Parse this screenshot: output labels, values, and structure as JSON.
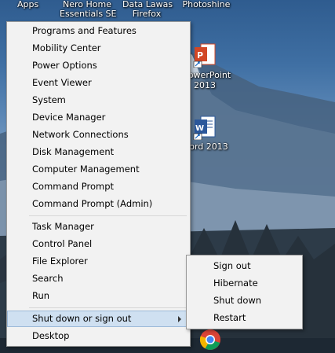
{
  "desktop": {
    "top_labels": {
      "apps": "Apps",
      "nero_line1": "Nero Home",
      "nero_line2": "Essentials SE",
      "data_line1": "Data Lawas",
      "data_line2": "Firefox",
      "photoshine": "Photoshine"
    },
    "icons": {
      "powerpoint_line1": "owerPoint",
      "powerpoint_line2": "2013",
      "word_label": "ord 2013"
    }
  },
  "context_menu": {
    "items": [
      {
        "label": "Programs and Features"
      },
      {
        "label": "Mobility Center"
      },
      {
        "label": "Power Options"
      },
      {
        "label": "Event Viewer"
      },
      {
        "label": "System"
      },
      {
        "label": "Device Manager"
      },
      {
        "label": "Network Connections"
      },
      {
        "label": "Disk Management"
      },
      {
        "label": "Computer Management"
      },
      {
        "label": "Command Prompt"
      },
      {
        "label": "Command Prompt (Admin)"
      },
      {
        "label": "Task Manager"
      },
      {
        "label": "Control Panel"
      },
      {
        "label": "File Explorer"
      },
      {
        "label": "Search"
      },
      {
        "label": "Run"
      },
      {
        "label": "Shut down or sign out"
      },
      {
        "label": "Desktop"
      }
    ]
  },
  "submenu": {
    "items": [
      {
        "label": "Sign out"
      },
      {
        "label": "Hibernate"
      },
      {
        "label": "Shut down"
      },
      {
        "label": "Restart"
      }
    ]
  },
  "colors": {
    "menu_bg": "#f2f2f2",
    "highlight": "#cfe0f1",
    "powerpoint": "#d24726",
    "word": "#2b579a"
  }
}
